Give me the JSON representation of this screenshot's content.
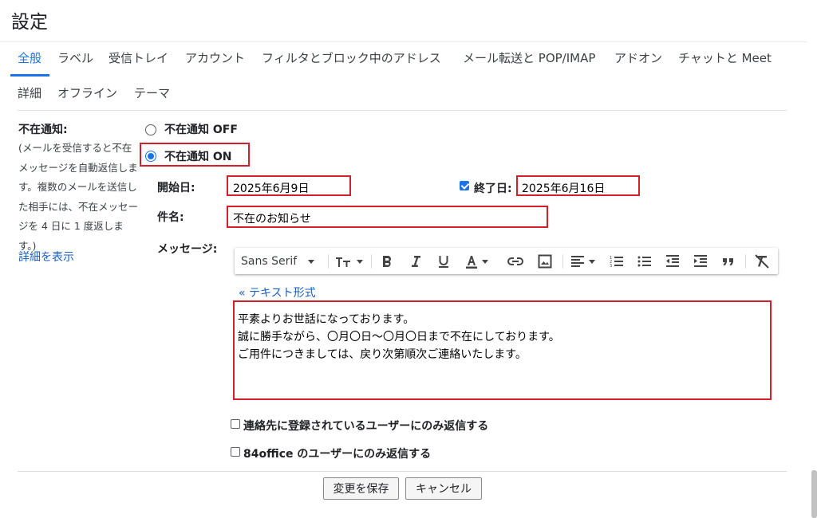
{
  "page": {
    "title": "設定"
  },
  "tabs": [
    {
      "label": "全般",
      "active": true
    },
    {
      "label": "ラベル"
    },
    {
      "label": "受信トレイ"
    },
    {
      "label": "アカウント"
    },
    {
      "label": "フィルタとブロック中のアドレス"
    },
    {
      "label": "メール転送と POP/IMAP"
    },
    {
      "label": "アドオン"
    },
    {
      "label": "チャットと Meet"
    },
    {
      "label": "詳細"
    },
    {
      "label": "オフライン"
    },
    {
      "label": "テーマ"
    }
  ],
  "vacation": {
    "label": "不在通知:",
    "description": "(メールを受信すると不在メッセージを自動返信します。複数のメールを送信した相手には、不在メッセージを 4 日に 1 度返します。)",
    "details_link": "詳細を表示",
    "option_off": "不在通知 OFF",
    "option_on": "不在通知 ON",
    "selected": "on",
    "start_label": "開始日:",
    "start_value": "2025年6月9日",
    "end_label": "終了日:",
    "end_checked": true,
    "end_value": "2025年6月16日",
    "subject_label": "件名:",
    "subject_value": "不在のお知らせ",
    "message_label": "メッセージ:",
    "text_mode_link": "« テキスト形式",
    "message_lines": [
      "平素よりお世話になっております。",
      "誠に勝手ながら、〇月〇日～〇月〇日まで不在にしております。",
      "ご用件につきましては、戻り次第順次ご連絡いたします。"
    ],
    "contacts_only_label": "連絡先に登録されているユーザーにのみ返信する",
    "contacts_only_checked": false,
    "domain_only_label": "84office のユーザーにのみ返信する",
    "domain_only_checked": false
  },
  "toolbar": {
    "font_name": "Sans Serif",
    "buttons": [
      "font-size",
      "bold",
      "italic",
      "underline",
      "text-color",
      "link",
      "image",
      "align",
      "numbered-list",
      "bulleted-list",
      "indent-less",
      "indent-more",
      "quote",
      "remove-formatting"
    ]
  },
  "actions": {
    "save_label": "変更を保存",
    "cancel_label": "キャンセル"
  },
  "colors": {
    "accent": "#1a73e8",
    "highlight_box": "#d2202a",
    "link": "#1a5fc7"
  }
}
